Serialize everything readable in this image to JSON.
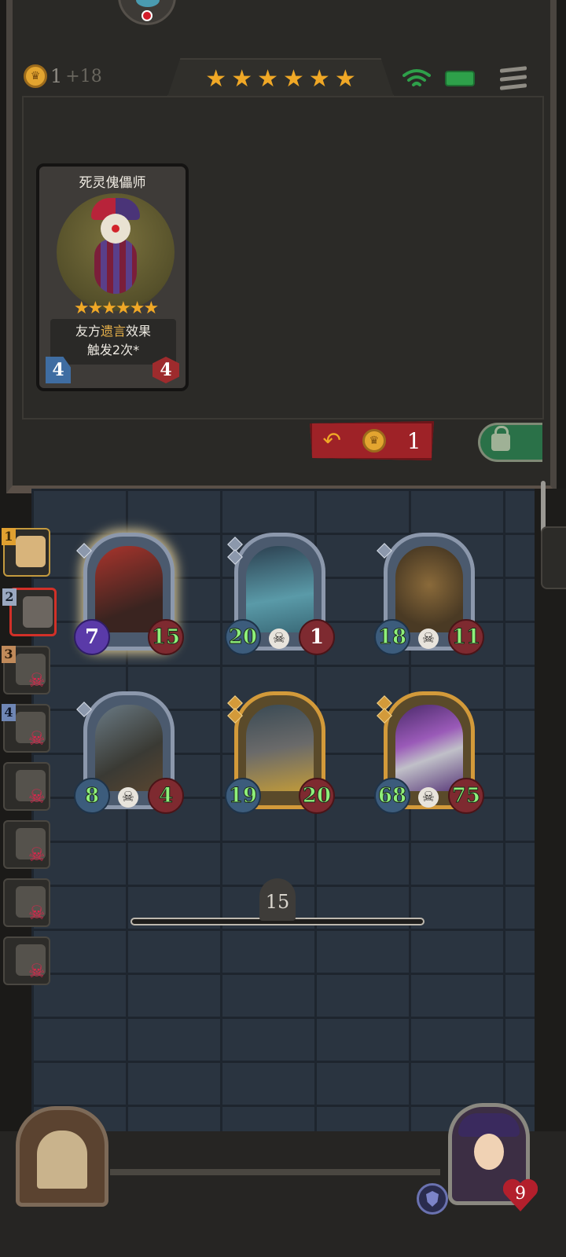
{
  "header": {
    "gold": "1",
    "gold_income": "+18",
    "tavern_stars": [
      "★",
      "★",
      "★",
      "★",
      "★",
      "★"
    ]
  },
  "shop_card": {
    "name": "死灵傀儡师",
    "stars": "★★★★★★",
    "desc_prefix": "友方",
    "desc_keyword": "遗言",
    "desc_suffix": "效果",
    "desc_line2": "触发2次*",
    "attack": "4",
    "health": "4"
  },
  "shop_actions": {
    "refresh_icon": "↶",
    "refresh_cost": "1"
  },
  "opponents": [
    {
      "rank": "1",
      "status": "active"
    },
    {
      "rank": "2",
      "status": "selected"
    },
    {
      "rank": "3",
      "status": "dead"
    },
    {
      "rank": "4",
      "status": "dead"
    },
    {
      "rank": "",
      "status": "dead"
    },
    {
      "rank": "",
      "status": "dead"
    },
    {
      "rank": "",
      "status": "dead"
    },
    {
      "rank": "",
      "status": "dead"
    }
  ],
  "board": {
    "row1": [
      {
        "attack": "7",
        "health": "15",
        "frame": "silver",
        "skull": false
      },
      {
        "attack": "20",
        "health": "1",
        "frame": "silver",
        "skull": true
      },
      {
        "attack": "18",
        "health": "11",
        "frame": "silver",
        "skull": true
      }
    ],
    "row2": [
      {
        "attack": "8",
        "health": "4",
        "frame": "silver",
        "skull": true
      },
      {
        "attack": "19",
        "health": "20",
        "frame": "gold",
        "skull": false
      },
      {
        "attack": "68",
        "health": "75",
        "frame": "gold",
        "skull": true
      }
    ]
  },
  "turn": {
    "number": "15"
  },
  "player": {
    "health": "9"
  },
  "colors": {
    "gold_star": "#f0a826",
    "refresh_red": "#9e2227",
    "lock_green": "#2a7148",
    "stat_green": "#8ef07a",
    "skull_red": "#e0244c"
  }
}
